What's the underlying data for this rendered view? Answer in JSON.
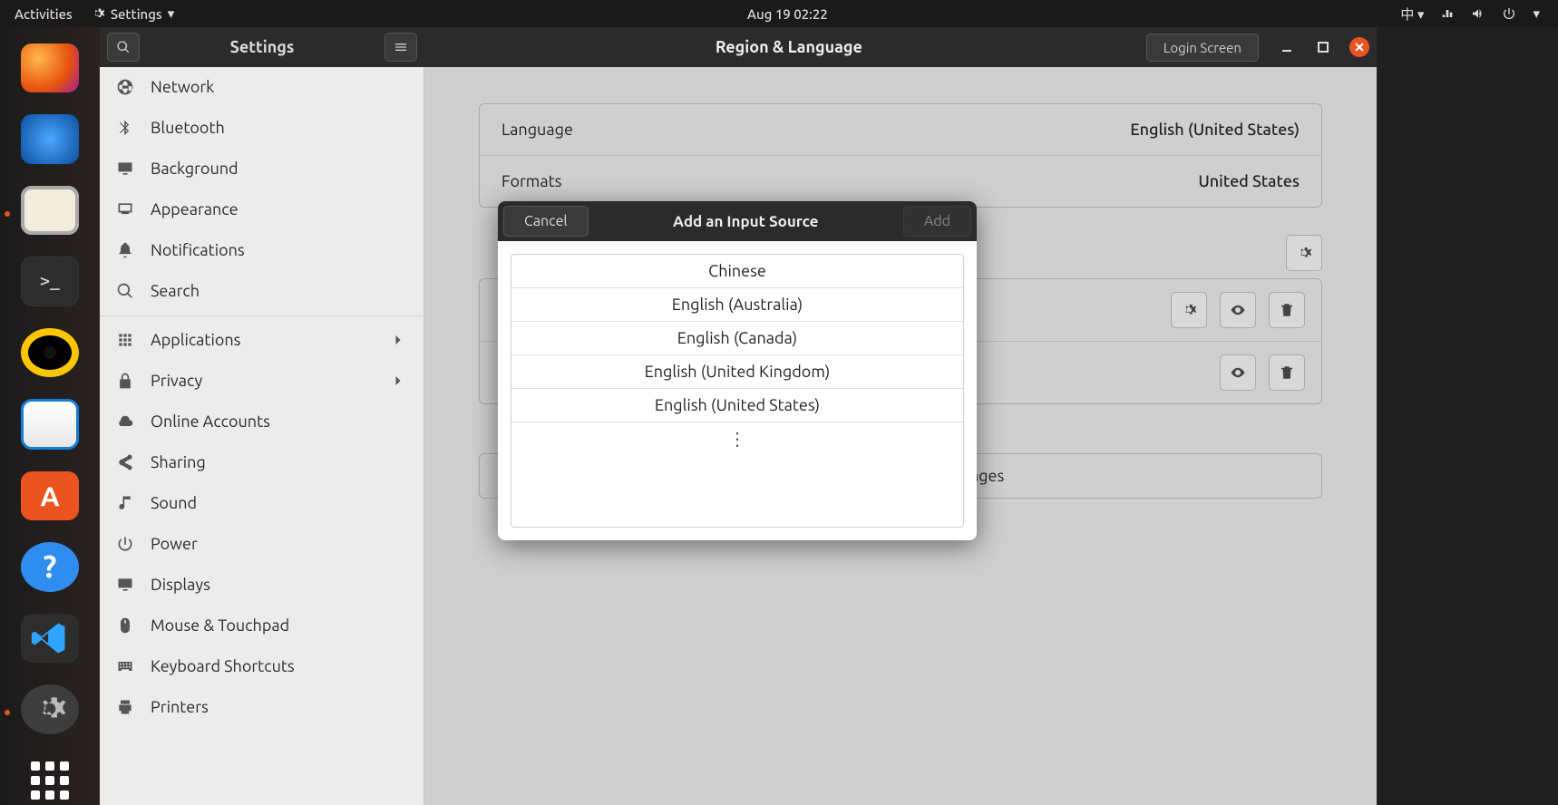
{
  "panel": {
    "activities": "Activities",
    "app_menu": "Settings",
    "clock": "Aug 19  02:22",
    "ime": "中"
  },
  "dock": [
    {
      "name": "firefox",
      "label": "Firefox"
    },
    {
      "name": "thunderbird",
      "label": "Thunderbird"
    },
    {
      "name": "files",
      "label": "Files",
      "running": true
    },
    {
      "name": "terminal",
      "label": "Terminal"
    },
    {
      "name": "rhythmbox",
      "label": "Rhythmbox"
    },
    {
      "name": "libreoffice-writer",
      "label": "LibreOffice Writer"
    },
    {
      "name": "software",
      "label": "Ubuntu Software"
    },
    {
      "name": "help",
      "label": "Help"
    },
    {
      "name": "vscode",
      "label": "Visual Studio Code"
    },
    {
      "name": "settings",
      "label": "Settings",
      "running": true
    },
    {
      "name": "show-apps",
      "label": "Show Applications"
    }
  ],
  "window": {
    "left_title": "Settings",
    "right_title": "Region & Language",
    "login_screen": "Login Screen"
  },
  "sidebar": [
    {
      "icon": "globe",
      "label": "Network"
    },
    {
      "icon": "bluetooth",
      "label": "Bluetooth"
    },
    {
      "icon": "display",
      "label": "Background"
    },
    {
      "icon": "appearance",
      "label": "Appearance"
    },
    {
      "icon": "bell",
      "label": "Notifications"
    },
    {
      "icon": "search",
      "label": "Search"
    },
    {
      "sep": true
    },
    {
      "icon": "grid",
      "label": "Applications",
      "chevron": true
    },
    {
      "icon": "lock",
      "label": "Privacy",
      "chevron": true
    },
    {
      "icon": "cloud",
      "label": "Online Accounts"
    },
    {
      "icon": "share",
      "label": "Sharing"
    },
    {
      "icon": "music",
      "label": "Sound"
    },
    {
      "icon": "power",
      "label": "Power"
    },
    {
      "icon": "display",
      "label": "Displays"
    },
    {
      "icon": "mouse",
      "label": "Mouse & Touchpad"
    },
    {
      "icon": "keyboard",
      "label": "Keyboard Shortcuts"
    },
    {
      "icon": "printer",
      "label": "Printers"
    }
  ],
  "region": {
    "language_label": "Language",
    "language_value": "English (United States)",
    "formats_label": "Formats",
    "formats_value": "United States",
    "manage_button": "Manage Installed Languages"
  },
  "dialog": {
    "cancel": "Cancel",
    "title": "Add an Input Source",
    "add": "Add",
    "items": [
      "Chinese",
      "English (Australia)",
      "English (Canada)",
      "English (United Kingdom)",
      "English (United States)"
    ]
  }
}
